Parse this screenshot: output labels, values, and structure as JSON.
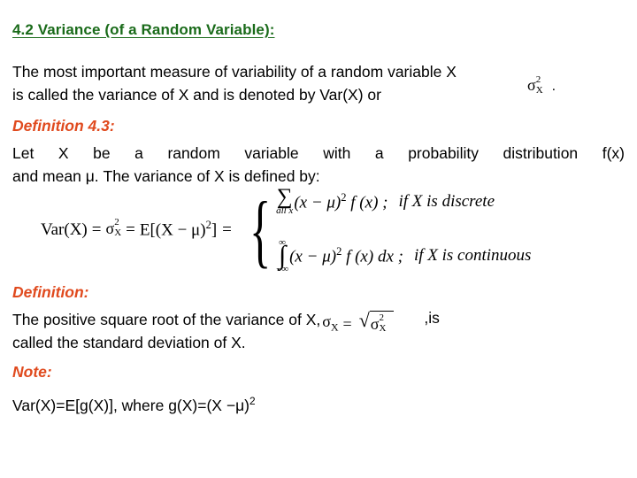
{
  "slide": {
    "title": "4.2 Variance (of a Random Variable):",
    "title_color": "#1a6b1a",
    "heading_color": "#e04a1e",
    "body_color": "#000000",
    "background": "#ffffff"
  },
  "intro": {
    "line1": "The most important measure of variability of a random variable X",
    "line2": "is called the variance of X and is denoted by Var(X) or",
    "inline_symbol": {
      "base": "σ",
      "superscript": "2",
      "subscript": "X"
    },
    "line2_end": "."
  },
  "definition_43": {
    "heading": "Definition 4.3:",
    "line1": "Let X be a random variable with a probability distribution f(x)",
    "line2": "and mean μ. The variance of X is defined by:"
  },
  "main_formula": {
    "lhs_var": "Var(X)",
    "eq1": "=",
    "sigma": "σ",
    "sigma_sup": "2",
    "sigma_sub": "X",
    "eq2": "=",
    "expectation": "E[(X − μ)",
    "expectation_sup": "2",
    "expectation_close": "]",
    "eq3": "=",
    "brace": "{",
    "cases": [
      {
        "operator": "∑",
        "limit_below": "all x",
        "limit_above": "",
        "expression_pre": "(x − μ)",
        "expression_sup": "2",
        "expression_post": "f (x) ;",
        "condition": "if  X is discrete"
      },
      {
        "operator": "∫",
        "limit_below": "−∞",
        "limit_above": "∞",
        "expression_pre": "(x − μ)",
        "expression_sup": "2",
        "expression_post": "f (x) dx ;",
        "condition": "if  X is continuous"
      }
    ]
  },
  "definition_2": {
    "heading": "Definition:",
    "line1_pre": "The positive square root of the variance of X,",
    "formula": {
      "sigma": "σ",
      "sigma_sub": "X",
      "equals": "=",
      "radical": "√",
      "radicand_base": "σ",
      "radicand_sup": "2",
      "radicand_sub": "X"
    },
    "line1_post": ",is",
    "line2": "called the standard deviation of X."
  },
  "note": {
    "heading": "Note:",
    "body_pre": "Var(X)=E[g(X)], where g(X)=(X ",
    "body_mu": "−μ",
    "body_sup": "2"
  }
}
